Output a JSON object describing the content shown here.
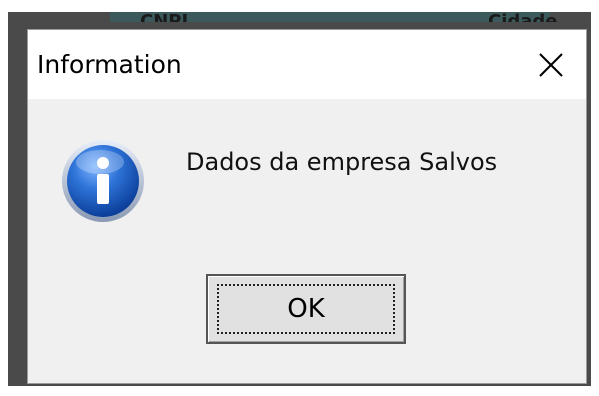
{
  "background_window": {
    "partial_text_left": "CNPJ",
    "partial_text_right": "Cidade"
  },
  "dialog": {
    "title": "Information",
    "close_glyph": "✕",
    "icon": "information-icon",
    "message": "Dados da empresa Salvos",
    "ok_label": "OK"
  },
  "colors": {
    "dialog_background": "#f0f0f0",
    "titlebar_background": "#ffffff",
    "icon_blue": "#1d5fc2",
    "button_face": "#e1e1e1"
  }
}
